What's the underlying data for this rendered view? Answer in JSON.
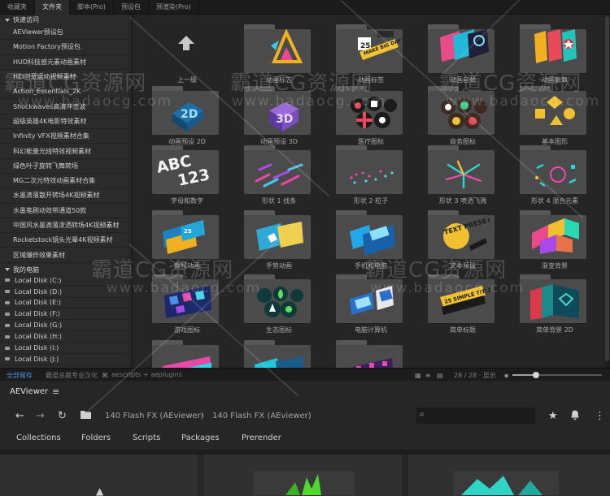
{
  "top_tabs": [
    "收藏夹",
    "文件夹",
    "脚本(Pro)",
    "预设包",
    "预渲染(Pro)"
  ],
  "sidebar": {
    "quick_access_title": "快速访问",
    "quick_items": [
      "AEViewer预设包",
      "Motion Factory预设包",
      "HUD科技感元素动画素材",
      "HEI创意运动视频素材",
      "Action_Essentials_2K",
      "Shockwaves高清冲击波",
      "超级英雄4K电影特效素材",
      "Infinity VFX视频素材合集",
      "科幻能量光线特效视频素材",
      "绿色叶子旋转飞舞转场",
      "MG二次元特效动画素材合集",
      "水墨滴落散开转场4K视频素材",
      "水墨笔刷动效带通道50款",
      "中国风水墨滴落泼洒转场4K视频素材",
      "Rocketstock镜头光晕4K视频素材",
      "区域爆炸效果素材"
    ],
    "computer_title": "我的电脑",
    "disks": [
      "Local Disk (C:)",
      "Local Disk (D:)",
      "Local Disk (E:)",
      "Local Disk (F:)",
      "Local Disk (G:)",
      "Local Disk (H:)",
      "Local Disk (I:)",
      "Local Disk (J:)"
    ]
  },
  "grid": {
    "items": [
      {
        "label": "上一级",
        "kind": "up-arrow-icon"
      },
      {
        "label": "动画标志",
        "kind": "folder"
      },
      {
        "label": "动画标签",
        "kind": "folder"
      },
      {
        "label": "动画音频",
        "kind": "folder"
      },
      {
        "label": "动画徽章",
        "kind": "folder"
      },
      {
        "label": "动画预设 2D",
        "kind": "folder"
      },
      {
        "label": "动画预设 3D",
        "kind": "folder"
      },
      {
        "label": "医疗图标",
        "kind": "folder"
      },
      {
        "label": "商务图标",
        "kind": "folder"
      },
      {
        "label": "基本图形",
        "kind": "folder"
      },
      {
        "label": "字母和数字",
        "kind": "folder"
      },
      {
        "label": "形状 1 线条",
        "kind": "folder"
      },
      {
        "label": "形状 2 粒子",
        "kind": "folder"
      },
      {
        "label": "形状 3 喷洒飞溅",
        "kind": "folder"
      },
      {
        "label": "形状 4 混合元素",
        "kind": "folder"
      },
      {
        "label": "教程动画",
        "kind": "folder"
      },
      {
        "label": "手势动画",
        "kind": "folder"
      },
      {
        "label": "手机和电脑",
        "kind": "folder"
      },
      {
        "label": "文本预设",
        "kind": "folder"
      },
      {
        "label": "渐变背景",
        "kind": "folder"
      },
      {
        "label": "游戏图标",
        "kind": "folder"
      },
      {
        "label": "生态图标",
        "kind": "folder"
      },
      {
        "label": "电脑计算机",
        "kind": "folder"
      },
      {
        "label": "简单标题",
        "kind": "folder"
      },
      {
        "label": "简单背景 2D",
        "kind": "folder"
      },
      {
        "label": "",
        "kind": "folder"
      },
      {
        "label": "",
        "kind": "folder"
      },
      {
        "label": "",
        "kind": "folder"
      }
    ],
    "art_texts": {
      "make_big_days": "MAKE BIG DAYS",
      "abc": "ABC",
      "num": "123",
      "two_d": "2D",
      "three_d": "3D",
      "num25": "25",
      "text_presets": "TEXT PRESETS",
      "simple_titles": "25 SIMPLE TITLES"
    }
  },
  "status_bar": {
    "select_all": "全部留存",
    "brand": "霸道总裁专业汉化",
    "plugin": "aescripts + aeplugins",
    "count": "28 / 28 · 显示",
    "zoom_level": 0.26
  },
  "viewer": {
    "title": "AEViewer",
    "breadcrumb": [
      "140 Flash FX (AEviewer)",
      "140 Flash FX (AEviewer)"
    ],
    "search_placeholder": "",
    "tabs": [
      "Collections",
      "Folders",
      "Scripts",
      "Packages",
      "Prerender"
    ]
  },
  "watermark": {
    "cn": "霸道CG资源网",
    "url": "www.badaocg.com"
  },
  "colors": {
    "accent_blue": "#4a8fe0",
    "folder": "#4b4b4b",
    "panel": "#2b2b2b"
  }
}
